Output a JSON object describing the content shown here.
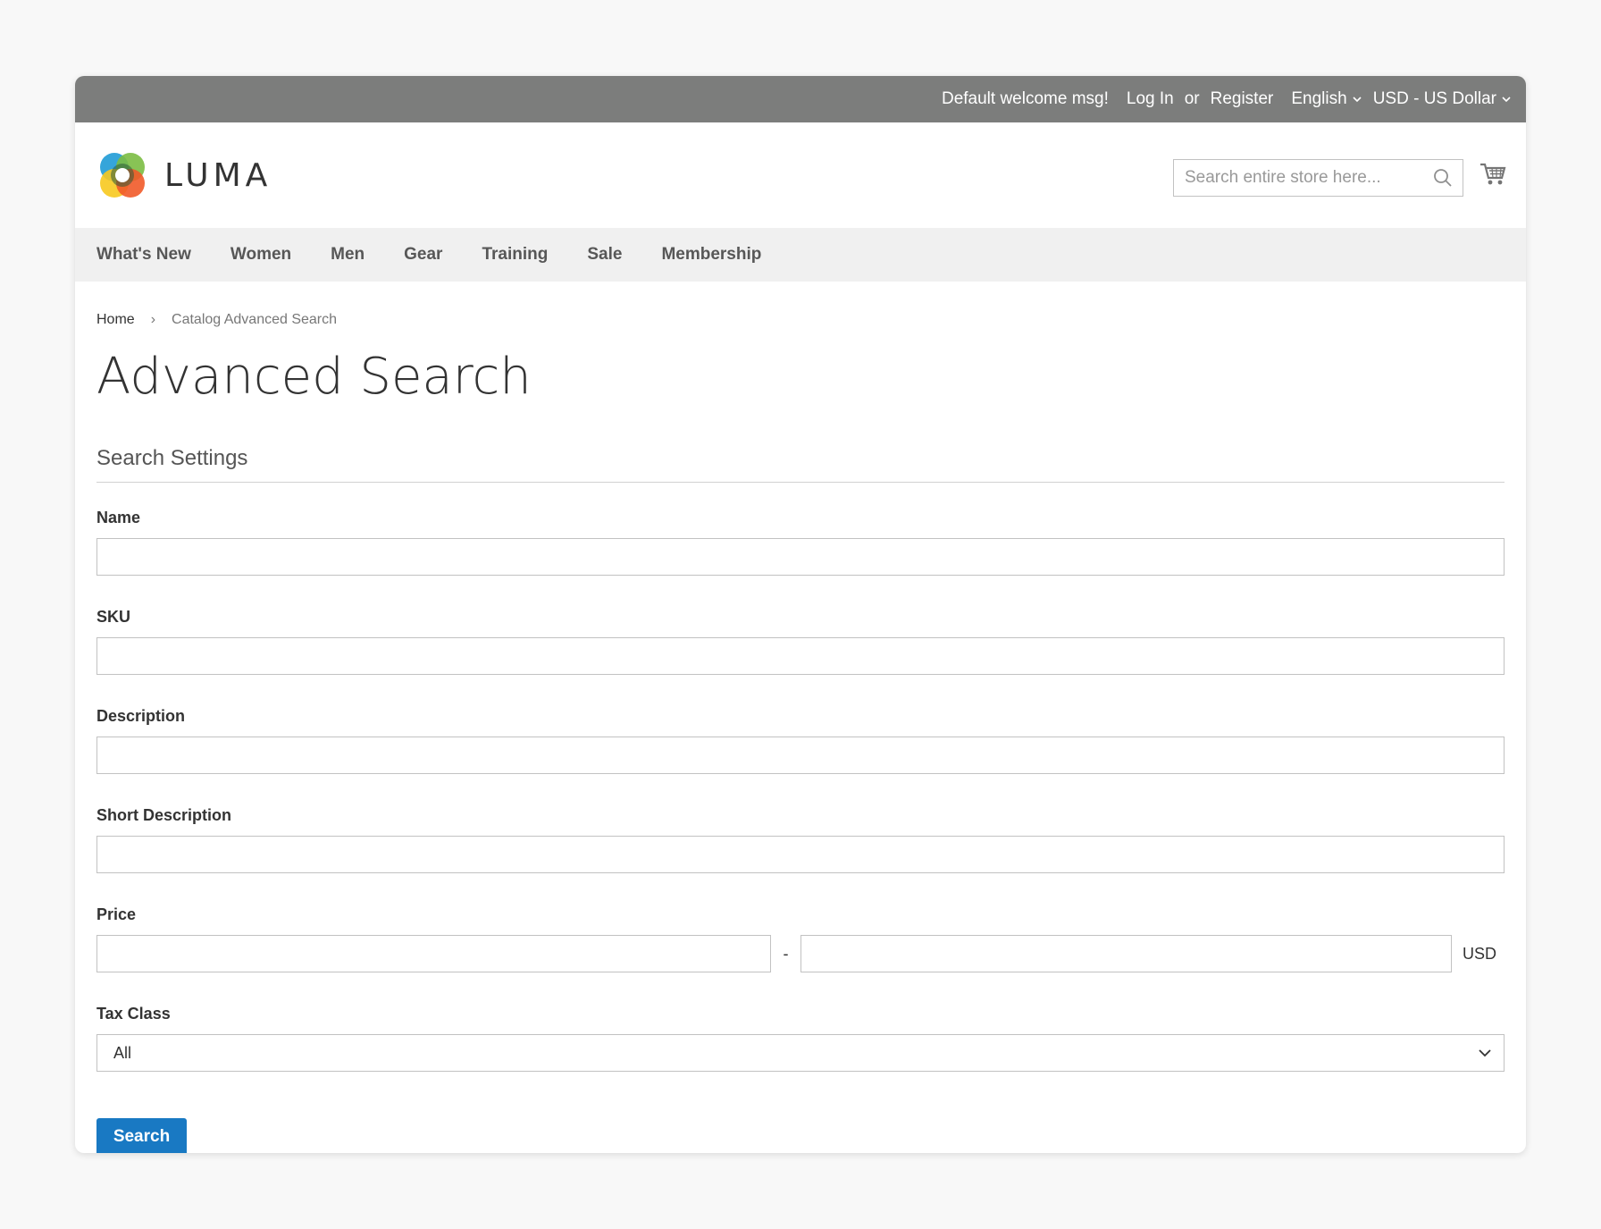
{
  "top_bar": {
    "welcome": "Default welcome msg!",
    "login": "Log In",
    "or": "or",
    "register": "Register",
    "language": "English",
    "currency": "USD - US Dollar",
    "background_color": "#7c7d7c"
  },
  "header": {
    "logo_text": "LUMA",
    "search_placeholder": "Search entire store here...",
    "icons": [
      "search-icon",
      "cart-icon"
    ]
  },
  "nav": {
    "items": [
      "What's New",
      "Women",
      "Men",
      "Gear",
      "Training",
      "Sale",
      "Membership"
    ]
  },
  "breadcrumb": {
    "home": "Home",
    "current": "Catalog Advanced Search"
  },
  "page": {
    "title": "Advanced Search",
    "legend": "Search Settings"
  },
  "form": {
    "name_label": "Name",
    "sku_label": "SKU",
    "description_label": "Description",
    "short_description_label": "Short Description",
    "price_label": "Price",
    "price_separator": "-",
    "price_currency": "USD",
    "tax_class_label": "Tax Class",
    "tax_class_value": "All",
    "submit_label": "Search",
    "button_color": "#1979c3"
  }
}
